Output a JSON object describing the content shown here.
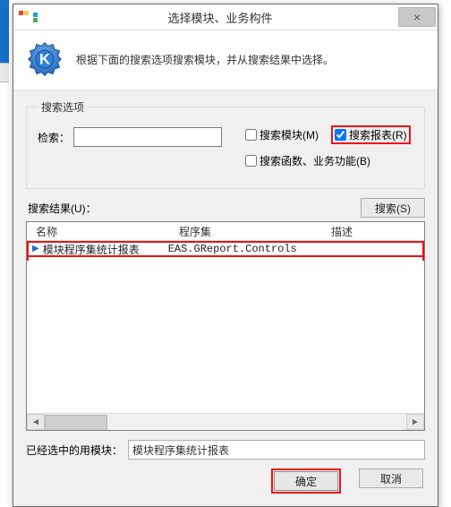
{
  "window": {
    "title": "选择模块、业务构件",
    "close_glyph": "×"
  },
  "banner": {
    "text": "根据下面的搜索选项搜索模块，并从搜索结果中选择。"
  },
  "options": {
    "legend": "搜索选项",
    "search_label": "检索：",
    "search_value": "",
    "checkboxes": {
      "module": {
        "label": "搜索模块(M)",
        "checked": false
      },
      "report": {
        "label": "搜索报表(R)",
        "checked": true
      },
      "func": {
        "label": "搜索函数、业务功能(B)",
        "checked": false
      }
    }
  },
  "results": {
    "label": "搜索结果(U)：",
    "search_button": "搜索(S)",
    "columns": {
      "name": "名称",
      "assembly": "程序集",
      "desc": "描述"
    },
    "rows": [
      {
        "name": "模块程序集统计报表",
        "assembly": "EAS.GReport.Controls",
        "desc": ""
      }
    ]
  },
  "selected": {
    "label": "已经选中的用模块：",
    "value": "模块程序集统计报表"
  },
  "footer": {
    "ok": "确定",
    "cancel": "取消"
  },
  "colors": {
    "annotation": "#ee1111",
    "border": "#828282",
    "accent": "#2b6dbf"
  }
}
